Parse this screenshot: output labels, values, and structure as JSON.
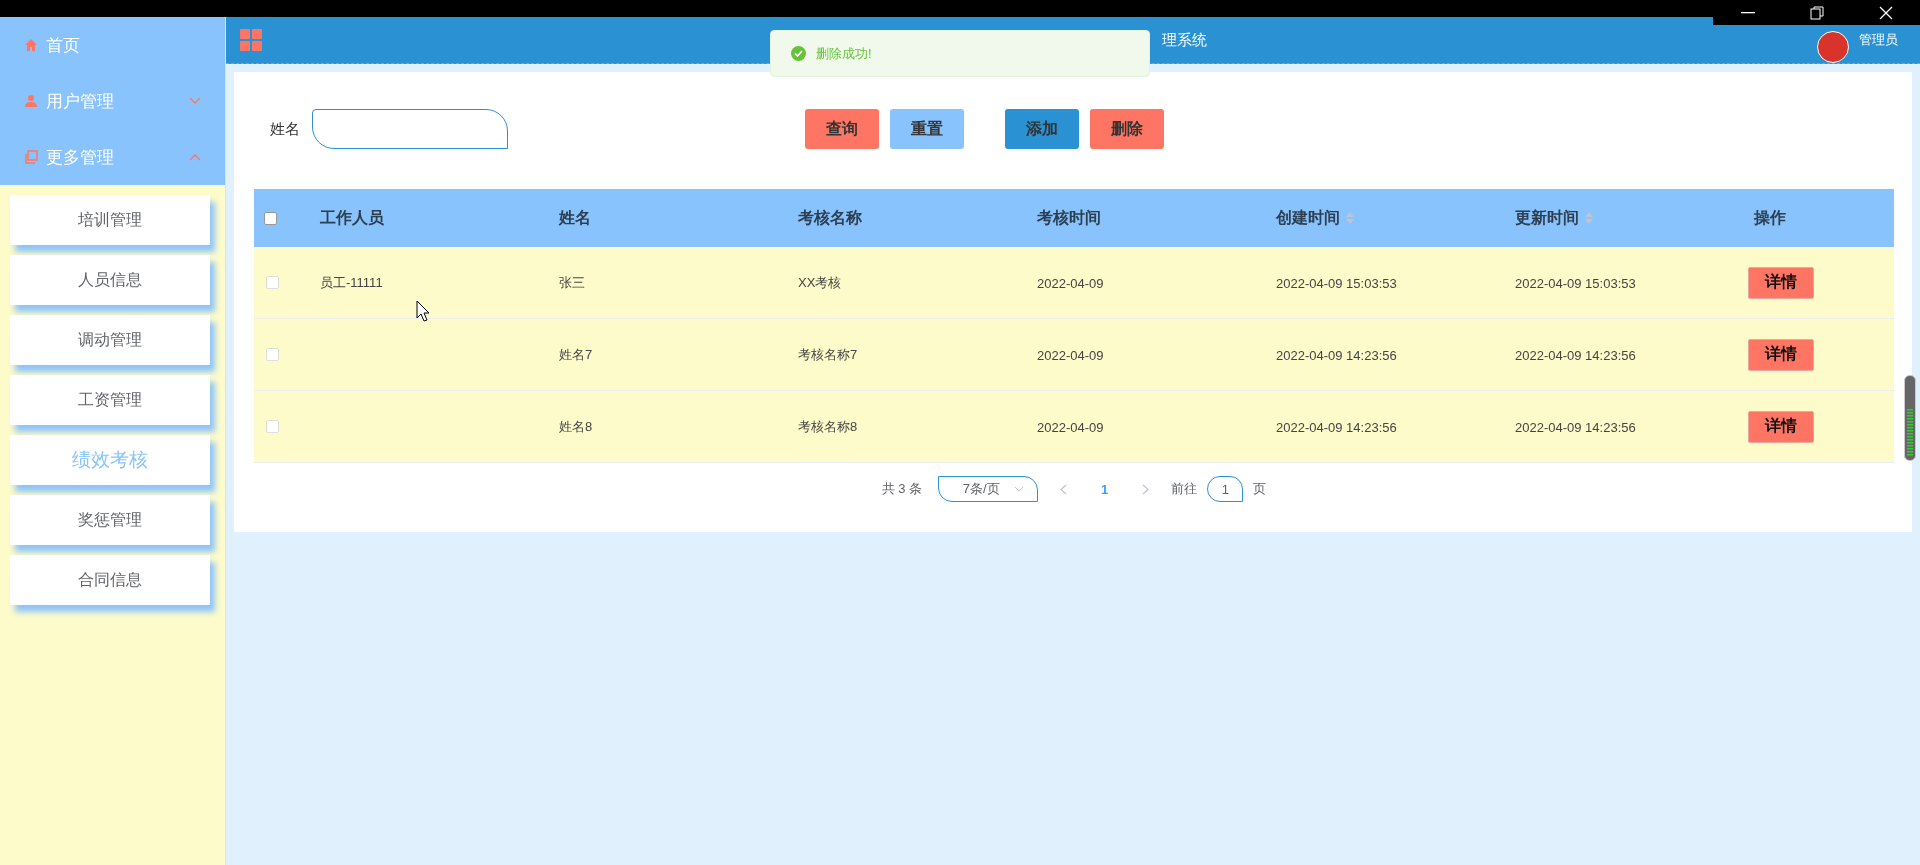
{
  "sidebar": {
    "items": [
      {
        "kind": "link",
        "label": "首页"
      },
      {
        "kind": "group",
        "label": "用户管理",
        "expanded": false
      },
      {
        "kind": "group",
        "label": "更多管理",
        "expanded": true,
        "children": [
          {
            "label": "培训管理",
            "selected": false
          },
          {
            "label": "人员信息",
            "selected": false
          },
          {
            "label": "调动管理",
            "selected": false
          },
          {
            "label": "工资管理",
            "selected": false
          },
          {
            "label": "绩效考核",
            "selected": true
          },
          {
            "label": "奖惩管理",
            "selected": false
          },
          {
            "label": "合同信息",
            "selected": false
          }
        ]
      }
    ]
  },
  "header": {
    "title": "理系统",
    "user": "管理员"
  },
  "toast": {
    "kind": "success",
    "message": "删除成功!"
  },
  "search": {
    "fields": [
      {
        "label": "姓名"
      }
    ],
    "buttons": [
      {
        "kind": "search",
        "label": "查询"
      },
      {
        "kind": "reset",
        "label": "重置"
      },
      {
        "kind": "add",
        "label": "添加"
      },
      {
        "kind": "delete",
        "label": "删除"
      }
    ]
  },
  "table": {
    "select_all": {
      "checked": false
    },
    "columns": [
      {
        "label": "工作人员",
        "sortable": false
      },
      {
        "label": "姓名",
        "sortable": false
      },
      {
        "label": "考核名称",
        "sortable": false
      },
      {
        "label": "考核时间",
        "sortable": false
      },
      {
        "label": "创建时间",
        "sortable": true
      },
      {
        "label": "更新时间",
        "sortable": true
      },
      {
        "label": "操作",
        "sortable": false
      }
    ],
    "rows": [
      {
        "checked": false,
        "cells": [
          "员工-11111",
          "张三",
          "XX考核",
          "2022-04-09",
          "2022-04-09 15:03:53",
          "2022-04-09 15:03:53"
        ],
        "action": "详情"
      },
      {
        "checked": false,
        "cells": [
          null,
          "姓名7",
          "考核名称7",
          "2022-04-09",
          "2022-04-09 14:23:56",
          "2022-04-09 14:23:56"
        ],
        "action": "详情"
      },
      {
        "checked": false,
        "cells": [
          null,
          "姓名8",
          "考核名称8",
          "2022-04-09",
          "2022-04-09 14:23:56",
          "2022-04-09 14:23:56"
        ],
        "action": "详情"
      }
    ]
  },
  "pagination": {
    "total": "共 3 条",
    "page_size": "7条/页",
    "pages": [
      {
        "label": "1",
        "selected": true
      }
    ],
    "goto_label": "前往",
    "goto_value": "1",
    "goto_suffix": "页"
  }
}
